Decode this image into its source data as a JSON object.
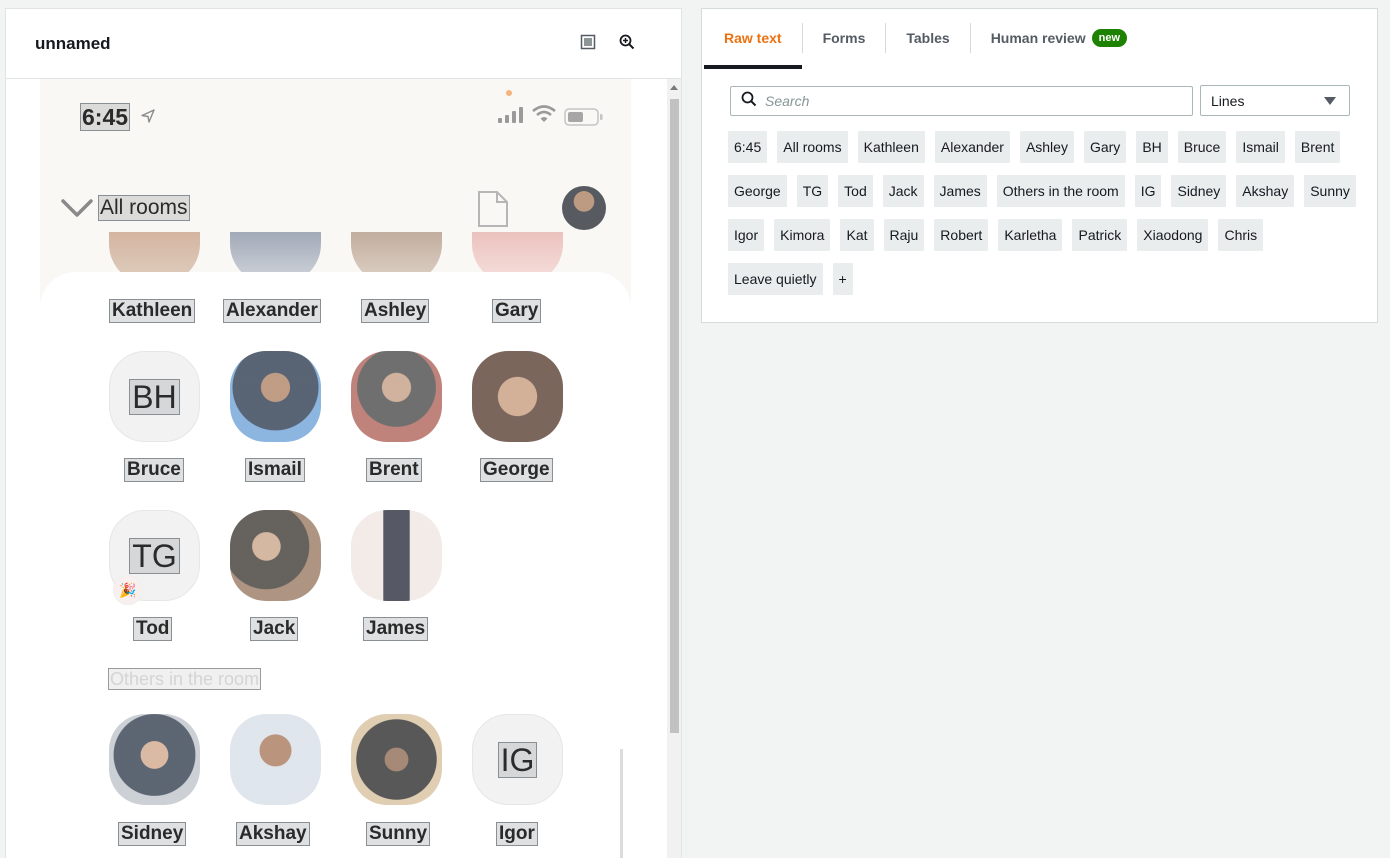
{
  "document": {
    "title": "unnamed"
  },
  "phone": {
    "time": "6:45",
    "rooms_title": "All rooms",
    "section_label": "Others in the room",
    "people": [
      {
        "name": "Kathleen"
      },
      {
        "name": "Alexander"
      },
      {
        "name": "Ashley"
      },
      {
        "name": "Gary"
      },
      {
        "name": "Bruce",
        "initials": "BH"
      },
      {
        "name": "Ismail"
      },
      {
        "name": "Brent"
      },
      {
        "name": "George"
      },
      {
        "name": "Tod",
        "initials": "TG"
      },
      {
        "name": "Jack"
      },
      {
        "name": "James"
      },
      {
        "name": "Sidney"
      },
      {
        "name": "Akshay"
      },
      {
        "name": "Sunny"
      },
      {
        "name": "Igor",
        "initials": "IG"
      }
    ]
  },
  "tabs": [
    {
      "label": "Raw text",
      "active": true
    },
    {
      "label": "Forms"
    },
    {
      "label": "Tables"
    },
    {
      "label": "Human review",
      "badge": "new"
    }
  ],
  "search": {
    "placeholder": "Search"
  },
  "view_select": {
    "value": "Lines"
  },
  "lines": [
    "6:45",
    "All rooms",
    "Kathleen",
    "Alexander",
    "Ashley",
    "Gary",
    "BH",
    "Bruce",
    "Ismail",
    "Brent",
    "George",
    "TG",
    "Tod",
    "Jack",
    "James",
    "Others in the room",
    "IG",
    "Sidney",
    "Akshay",
    "Sunny",
    "Igor",
    "Kimora",
    "Kat",
    "Raju",
    "Robert",
    "Karletha",
    "Patrick",
    "Xiaodong",
    "Chris",
    "Leave quietly",
    "+"
  ],
  "colors": {
    "accent": "#ec7211",
    "badge": "#1d8102",
    "chip_bg": "#eaeded"
  }
}
